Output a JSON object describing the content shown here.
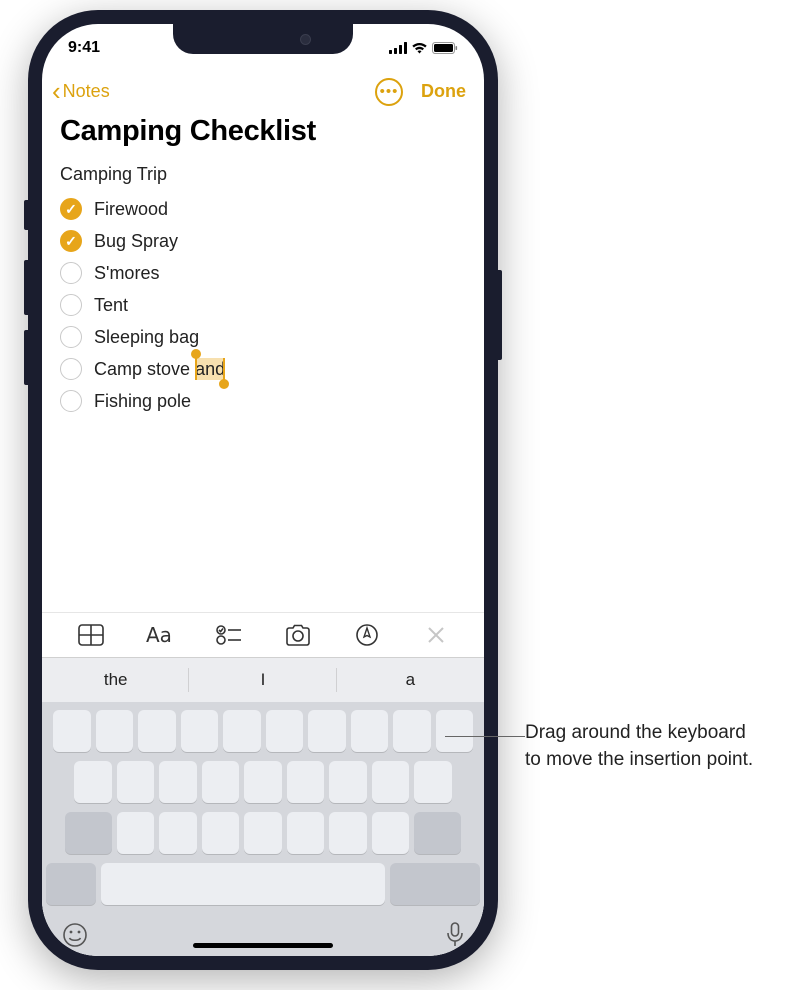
{
  "status": {
    "time": "9:41"
  },
  "nav": {
    "back_label": "Notes",
    "done_label": "Done"
  },
  "title": "Camping Checklist",
  "note": {
    "heading": "Camping Trip",
    "items": [
      {
        "label": "Firewood",
        "checked": true
      },
      {
        "label": "Bug Spray",
        "checked": true
      },
      {
        "label": "S'mores",
        "checked": false
      },
      {
        "label": "Tent",
        "checked": false
      },
      {
        "label": "Sleeping bag",
        "checked": false
      },
      {
        "label_pre": "Camp stove",
        "label_sel": "and",
        "checked": false
      },
      {
        "label": "Fishing pole",
        "checked": false
      }
    ]
  },
  "suggestions": [
    "the",
    "I",
    "a"
  ],
  "callout": "Drag around the keyboard to move the insertion point.",
  "colors": {
    "accent": "#e7a51a"
  }
}
